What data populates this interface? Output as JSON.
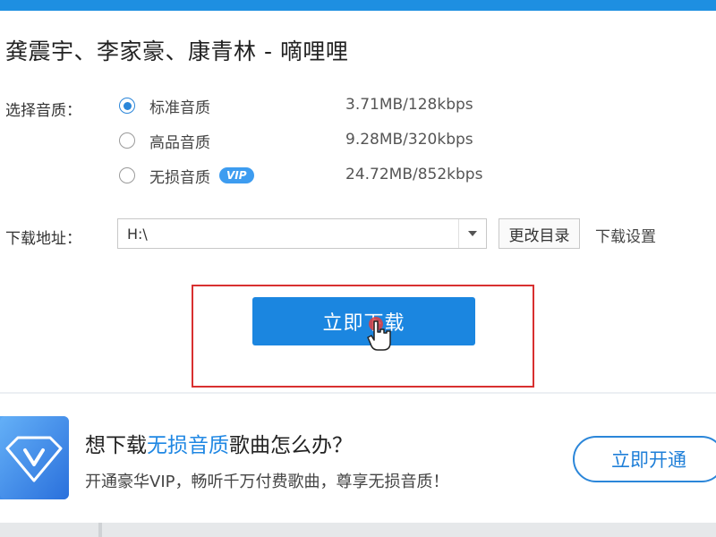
{
  "window": {
    "title": "龚震宇、李家豪、康青林 - 嘀哩哩"
  },
  "quality": {
    "label": "选择音质：",
    "options": [
      {
        "label": "标准音质",
        "size": "3.71MB/128kbps",
        "selected": true
      },
      {
        "label": "高品音质",
        "size": "9.28MB/320kbps",
        "selected": false
      },
      {
        "label": "无损音质",
        "size": "24.72MB/852kbps",
        "selected": false,
        "badge": "VIP"
      }
    ]
  },
  "download": {
    "path_label": "下载地址：",
    "path_value": "H:\\",
    "change_dir_label": "更改目录",
    "settings_label": "下载设置",
    "button_label": "立即下载"
  },
  "promo": {
    "title_prefix": "想下载",
    "title_highlight": "无损音质",
    "title_suffix": "歌曲怎么办？",
    "subtitle": "开通豪华VIP，畅听千万付费歌曲，尊享无损音质！",
    "button_label": "立即开通"
  },
  "colors": {
    "accent": "#1b86e0",
    "highlight_border": "#d83030",
    "topbar": "#1e8fe1"
  }
}
